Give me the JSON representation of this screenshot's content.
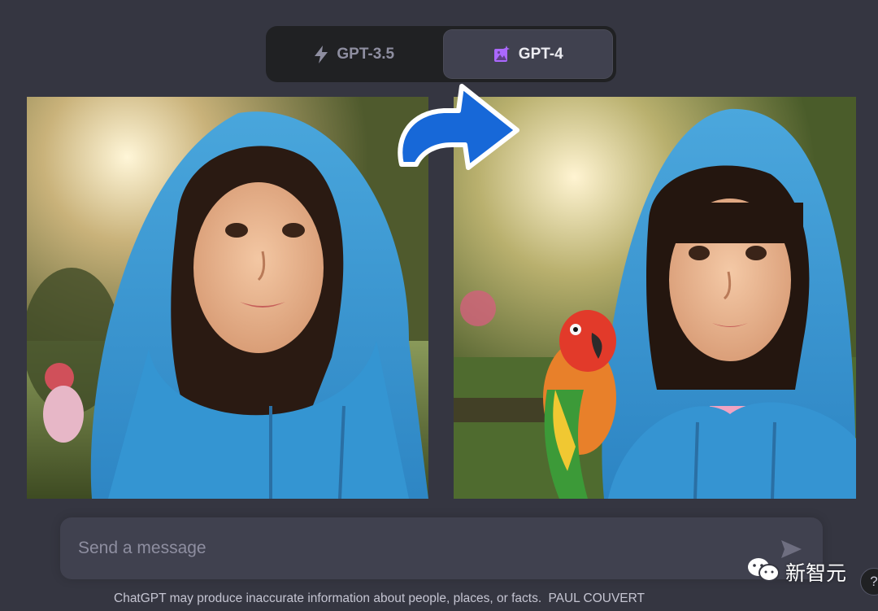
{
  "model_switcher": {
    "models": [
      {
        "label": "GPT-3.5",
        "icon": "lightning-bolt-icon",
        "active": false
      },
      {
        "label": "GPT-4",
        "icon": "sparkle-image-icon",
        "active": true
      }
    ],
    "active_color": "#ab68ff"
  },
  "images": {
    "left_alt": "girl-in-blue-hoodie-gpt35",
    "right_alt": "girl-in-blue-hoodie-with-parrot-gpt4"
  },
  "arrow": {
    "icon": "curved-arrow-right-icon",
    "color": "#1a6fe0"
  },
  "composer": {
    "placeholder": "Send a message",
    "send_icon": "send-icon"
  },
  "watermark": {
    "text": "新智元",
    "icon": "wechat-icon"
  },
  "help": {
    "label": "?"
  },
  "footer": {
    "disclaimer": "ChatGPT may produce inaccurate information about people, places, or facts.",
    "credit": "PAUL COUVERT"
  }
}
